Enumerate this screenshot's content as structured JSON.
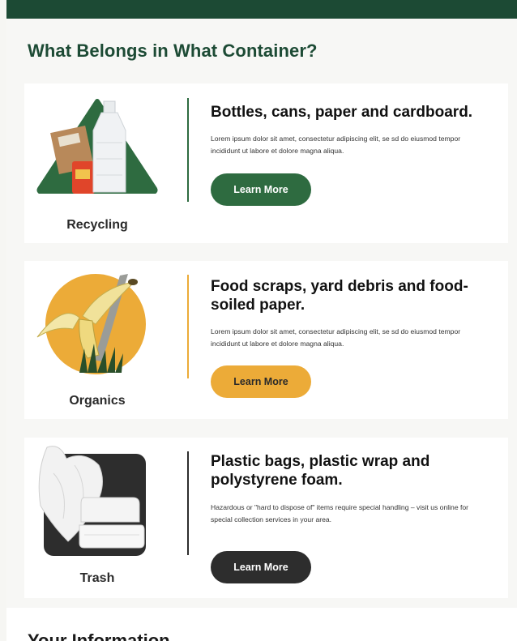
{
  "page": {
    "title": "What Belongs in What Container?",
    "next_section_title": "Your Information"
  },
  "colors": {
    "brand_dark_green": "#1c4a34",
    "recycling_green": "#2e6b40",
    "organics_gold": "#ecab38",
    "trash_dark": "#2d2d2d"
  },
  "containers": [
    {
      "label": "Recycling",
      "icon": "recycling-triangle-icon",
      "heading": "Bottles, cans, paper and cardboard.",
      "body": "Lorem ipsum dolor sit amet, consectetur adipiscing elit, se sd do eiusmod tempor incididunt ut labore et dolore magna aliqua.",
      "button_label": "Learn More"
    },
    {
      "label": "Organics",
      "icon": "organics-circle-icon",
      "heading": "Food scraps, yard debris and food-soiled paper.",
      "body": "Lorem ipsum dolor sit amet, consectetur adipiscing elit, se sd do eiusmod tempor incididunt ut labore et dolore magna aliqua.",
      "button_label": "Learn More"
    },
    {
      "label": "Trash",
      "icon": "trash-square-icon",
      "heading": "Plastic bags, plastic wrap and polystyrene foam.",
      "body": "Hazardous or \"hard to dispose of\" items require special handling – visit us online for special collection services in your area.",
      "button_label": "Learn More"
    }
  ]
}
